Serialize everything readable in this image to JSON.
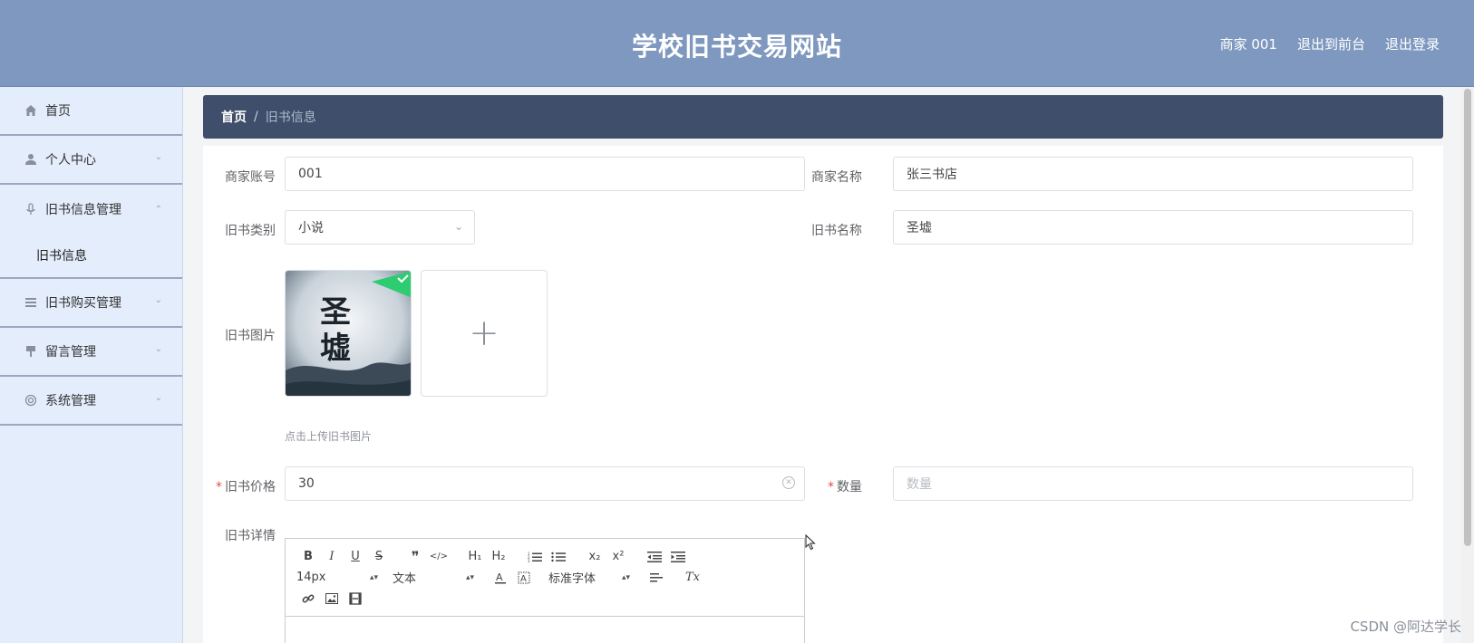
{
  "header": {
    "title": "学校旧书交易网站",
    "user": "商家 001",
    "back_to_front": "退出到前台",
    "logout": "退出登录"
  },
  "sidebar": {
    "items": [
      {
        "label": "首页",
        "icon": "home-icon"
      },
      {
        "label": "个人中心",
        "icon": "user-icon"
      },
      {
        "label": "旧书信息管理",
        "icon": "mic-icon"
      },
      {
        "label": "旧书信息"
      },
      {
        "label": "旧书购买管理",
        "icon": "list-icon"
      },
      {
        "label": "留言管理",
        "icon": "brush-icon"
      },
      {
        "label": "系统管理",
        "icon": "lifebuoy-icon"
      }
    ]
  },
  "breadcrumb": {
    "home": "首页",
    "separator": "/",
    "current": "旧书信息"
  },
  "form": {
    "merchant_account_label": "商家账号",
    "merchant_account_value": "001",
    "merchant_name_label": "商家名称",
    "merchant_name_value": "张三书店",
    "category_label": "旧书类别",
    "category_value": "小说",
    "book_name_label": "旧书名称",
    "book_name_value": "圣墟",
    "image_label": "旧书图片",
    "cover_text": "圣墟",
    "upload_hint": "点击上传旧书图片",
    "price_label": "旧书价格",
    "price_value": "30",
    "quantity_label": "数量",
    "quantity_placeholder": "数量",
    "details_label": "旧书详情",
    "required_mark": "*"
  },
  "editor": {
    "font_size": "14px",
    "text_type": "文本",
    "font_family": "标准字体",
    "buttons": {
      "bold": "B",
      "italic": "I",
      "underline": "U",
      "strike": "S",
      "quote": "❞",
      "code": "</>",
      "h1": "H₁",
      "h2": "H₂",
      "subscript": "x₂",
      "superscript": "x²",
      "clear": "Tx"
    }
  },
  "watermark": "CSDN @阿达学长"
}
